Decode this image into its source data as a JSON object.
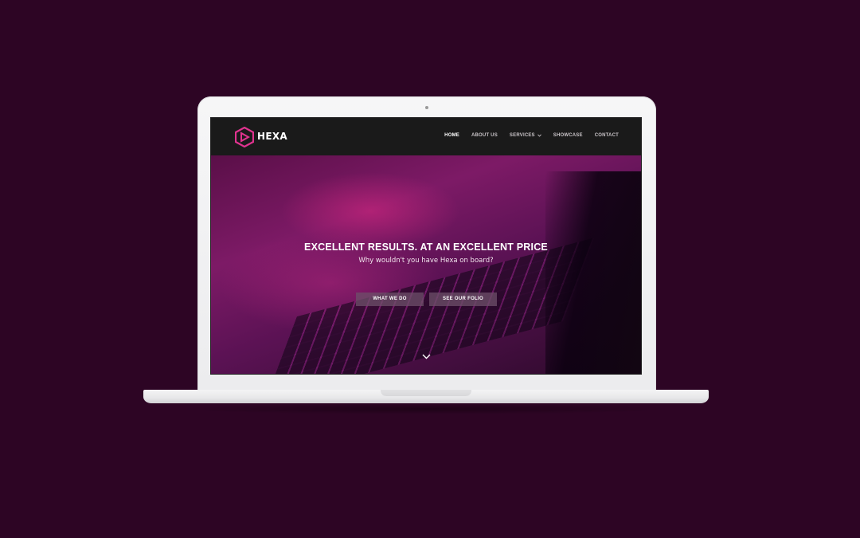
{
  "brand": {
    "name": "HEXA",
    "accent": "#e0338f"
  },
  "nav": {
    "items": [
      {
        "label": "HOME",
        "active": true
      },
      {
        "label": "ABOUT US",
        "active": false
      },
      {
        "label": "SERVICES",
        "active": false,
        "has_dropdown": true
      },
      {
        "label": "SHOWCASE",
        "active": false
      },
      {
        "label": "CONTACT",
        "active": false
      }
    ]
  },
  "hero": {
    "title": "EXCELLENT RESULTS. AT AN EXCELLENT PRICE",
    "subtitle": "Why wouldn't you have Hexa on board?",
    "buttons": {
      "primary": "WHAT WE DO",
      "secondary": "SEE OUR FOLIO"
    },
    "scroll_icon": "chevron-down-icon"
  },
  "colors": {
    "background": "#2d0524",
    "navbar": "#1a1a1a",
    "button": "#6e5069"
  }
}
